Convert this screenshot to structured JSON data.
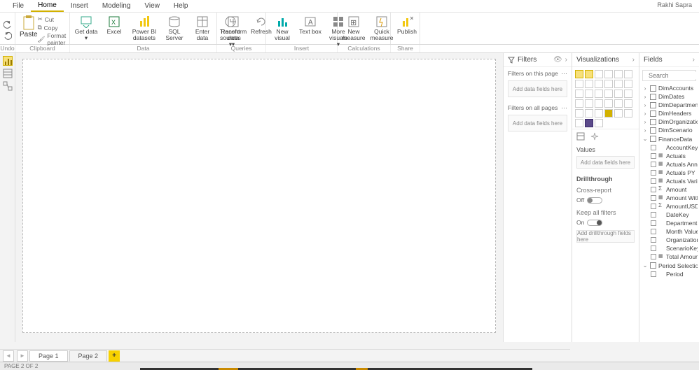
{
  "user_label": "Rakhi Sapra",
  "menubar": {
    "tabs": [
      "File",
      "Home",
      "Insert",
      "Modeling",
      "View",
      "Help"
    ],
    "active": 1
  },
  "ribbon": {
    "undo_group": "Undo",
    "clipboard": {
      "paste": "Paste",
      "cut": "Cut",
      "copy": "Copy",
      "format_painter": "Format painter",
      "group": "Clipboard"
    },
    "data": {
      "get_data": "Get data",
      "excel": "Excel",
      "pbids": "Power BI datasets",
      "sql": "SQL Server",
      "enter": "Enter data",
      "recent": "Recent sources",
      "group": "Data"
    },
    "queries": {
      "transform": "Transform data",
      "refresh": "Refresh",
      "group": "Queries"
    },
    "insert": {
      "new_visual": "New visual",
      "text_box": "Text box",
      "more": "More visuals",
      "group": "Insert"
    },
    "calc": {
      "new_measure": "New measure",
      "quick_measure": "Quick measure",
      "group": "Calculations"
    },
    "share": {
      "publish": "Publish",
      "group": "Share"
    }
  },
  "filters": {
    "title": "Filters",
    "on_page": "Filters on this page",
    "on_all": "Filters on all pages",
    "placeholder": "Add data fields here"
  },
  "viz": {
    "title": "Visualizations",
    "values": "Values",
    "values_placeholder": "Add data fields here",
    "drill": "Drillthrough",
    "cross": "Cross-report",
    "off": "Off",
    "keep": "Keep all filters",
    "on": "On",
    "drill_placeholder": "Add drillthrough fields here"
  },
  "fields": {
    "title": "Fields",
    "search_placeholder": "Search",
    "tables": [
      {
        "name": "DimAccounts",
        "expanded": false
      },
      {
        "name": "DimDates",
        "expanded": false
      },
      {
        "name": "DimDepartments",
        "expanded": false
      },
      {
        "name": "DimHeaders",
        "expanded": false
      },
      {
        "name": "DimOrganizations",
        "expanded": false
      },
      {
        "name": "DimScenario",
        "expanded": false
      },
      {
        "name": "FinanceData",
        "expanded": true,
        "fields": [
          {
            "name": "AccountKey",
            "type": ""
          },
          {
            "name": "Actuals",
            "type": "calc"
          },
          {
            "name": "Actuals Annu...",
            "type": "calc"
          },
          {
            "name": "Actuals PY",
            "type": "calc"
          },
          {
            "name": "Actuals Varian...",
            "type": "calc"
          },
          {
            "name": "Amount",
            "type": "sum"
          },
          {
            "name": "Amount With ...",
            "type": "calc"
          },
          {
            "name": "AmountUSD",
            "type": "sum"
          },
          {
            "name": "DateKey",
            "type": ""
          },
          {
            "name": "DepartmentKey",
            "type": ""
          },
          {
            "name": "Month Value",
            "type": ""
          },
          {
            "name": "OrganizationK...",
            "type": ""
          },
          {
            "name": "ScenarioKey",
            "type": ""
          },
          {
            "name": "Total Amount",
            "type": "calc"
          }
        ]
      },
      {
        "name": "Period Selection",
        "expanded": true,
        "fields": [
          {
            "name": "Period",
            "type": ""
          }
        ]
      }
    ]
  },
  "pages": {
    "tabs": [
      "Page 1",
      "Page 2"
    ],
    "active": 1,
    "status": "PAGE 2 OF 2"
  }
}
